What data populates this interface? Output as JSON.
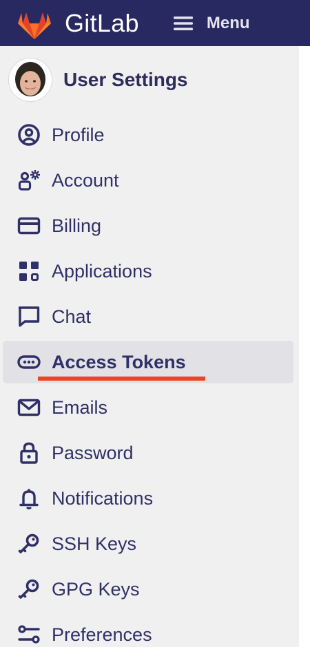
{
  "topbar": {
    "brand": "GitLab",
    "menu_label": "Menu",
    "colors": {
      "background": "#292961",
      "logo_orange": "#fc6d26",
      "logo_red": "#e24329",
      "logo_light": "#fca326"
    }
  },
  "sidebar": {
    "title": "User Settings",
    "active_item": "Access Tokens",
    "items": [
      {
        "label": "Profile",
        "icon": "profile-icon"
      },
      {
        "label": "Account",
        "icon": "account-icon"
      },
      {
        "label": "Billing",
        "icon": "billing-icon"
      },
      {
        "label": "Applications",
        "icon": "applications-icon"
      },
      {
        "label": "Chat",
        "icon": "chat-icon"
      },
      {
        "label": "Access Tokens",
        "icon": "token-icon"
      },
      {
        "label": "Emails",
        "icon": "mail-icon"
      },
      {
        "label": "Password",
        "icon": "lock-icon"
      },
      {
        "label": "Notifications",
        "icon": "bell-icon"
      },
      {
        "label": "SSH Keys",
        "icon": "key-icon"
      },
      {
        "label": "GPG Keys",
        "icon": "key-icon"
      },
      {
        "label": "Preferences",
        "icon": "preferences-icon"
      }
    ]
  },
  "colors": {
    "sidebar_bg": "#f0f0f0",
    "text": "#303068",
    "active_bg": "#e2e2e6",
    "annotation_underline": "#ef4423"
  }
}
